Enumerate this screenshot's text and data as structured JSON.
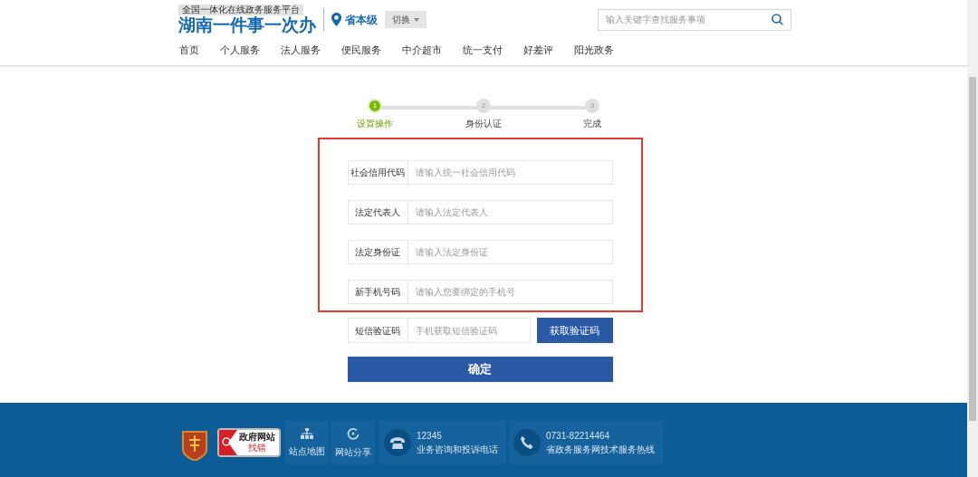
{
  "header": {
    "tagline": "全国一体化在线政务服务平台",
    "logo": "湖南一件事一次办",
    "region": "省本级",
    "switch_button": "切换",
    "search": {
      "placeholder": "输入关键字查找服务事项"
    }
  },
  "nav": [
    {
      "label": "首页"
    },
    {
      "label": "个人服务"
    },
    {
      "label": "法人服务"
    },
    {
      "label": "便民服务"
    },
    {
      "label": "中介超市"
    },
    {
      "label": "统一支付"
    },
    {
      "label": "好差评"
    },
    {
      "label": "阳光政务"
    }
  ],
  "steps": [
    {
      "number": "1",
      "label": "设置操作",
      "selected": true
    },
    {
      "number": "2",
      "label": "身份认证",
      "selected": false
    },
    {
      "number": "3",
      "label": "完成",
      "selected": false
    }
  ],
  "form_fields": [
    {
      "label": "社会信用代码",
      "placeholder": "请输入统一社会信用代码"
    },
    {
      "label": "法定代表人",
      "placeholder": "请输入法定代表人"
    },
    {
      "label": "法定身份证",
      "placeholder": "请输入法定身份证"
    },
    {
      "label": "新手机号码",
      "placeholder": "请输入您要绑定的手机号"
    }
  ],
  "sms": {
    "label": "短信验证码",
    "placeholder": "手机获取短信验证码",
    "button": "获取验证码"
  },
  "submit_button": "确定",
  "footer": {
    "links": [
      {
        "kind": "sitemap",
        "label": "站点地图"
      },
      {
        "kind": "share",
        "label": "网站分享"
      }
    ],
    "hotlines": [
      {
        "kind": "phone",
        "number": "12345",
        "label": "业务咨询和投诉电话"
      },
      {
        "kind": "call",
        "number": "0731-82214464",
        "label": "省政务服务网技术服务热线"
      }
    ],
    "error_badge": {
      "title": "政府网站",
      "subtitle": "找错"
    }
  }
}
